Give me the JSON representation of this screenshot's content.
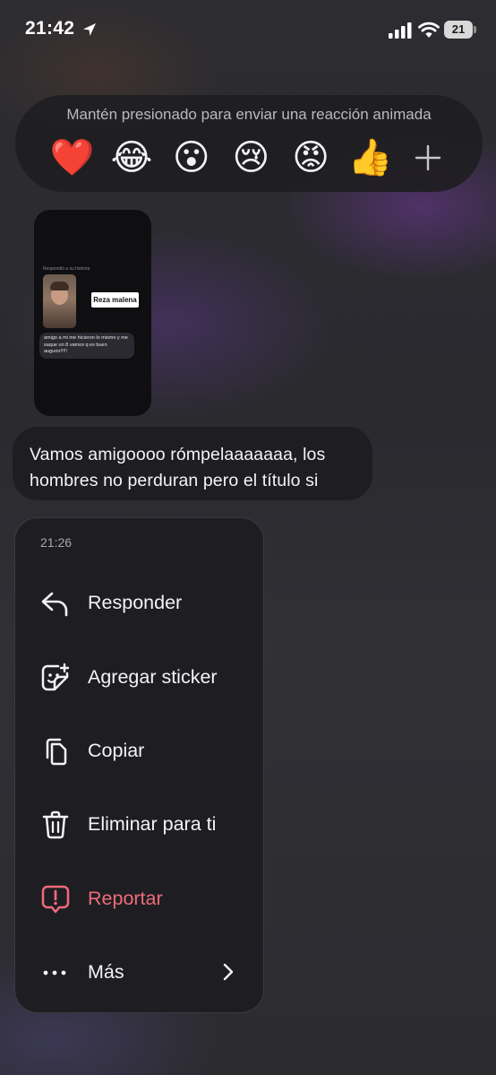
{
  "status_bar": {
    "time": "21:42",
    "battery": "21"
  },
  "reaction_bar": {
    "hint": "Mantén presionado para enviar una reacción animada",
    "reactions": [
      {
        "emoji": "❤️",
        "name": "heart"
      },
      {
        "emoji": "😂",
        "name": "laughing"
      },
      {
        "emoji": "😮",
        "name": "surprised"
      },
      {
        "emoji": "😢",
        "name": "crying"
      },
      {
        "emoji": "😡",
        "name": "angry"
      },
      {
        "emoji": "👍",
        "name": "thumbs-up"
      }
    ],
    "more_icon": "plus-icon"
  },
  "story": {
    "caption": "Respondió a su historia",
    "sticker": "Reza malena",
    "reply": "amigo a mi me hicieron lo mismo y me saque un 8 vamos q es buen augurio!!!!!"
  },
  "message": {
    "text": "Vamos amigoooo rómpelaaaaaaa,  los hombres no perduran pero el título si"
  },
  "context_menu": {
    "time": "21:26",
    "items": [
      {
        "label": "Responder",
        "icon": "reply-icon"
      },
      {
        "label": "Agregar sticker",
        "icon": "sticker-icon"
      },
      {
        "label": "Copiar",
        "icon": "copy-icon"
      },
      {
        "label": "Eliminar para ti",
        "icon": "trash-icon"
      },
      {
        "label": "Reportar",
        "icon": "report-icon",
        "color": "#ee6b7a"
      },
      {
        "label": "Más",
        "icon": "more-dots-icon"
      }
    ]
  }
}
